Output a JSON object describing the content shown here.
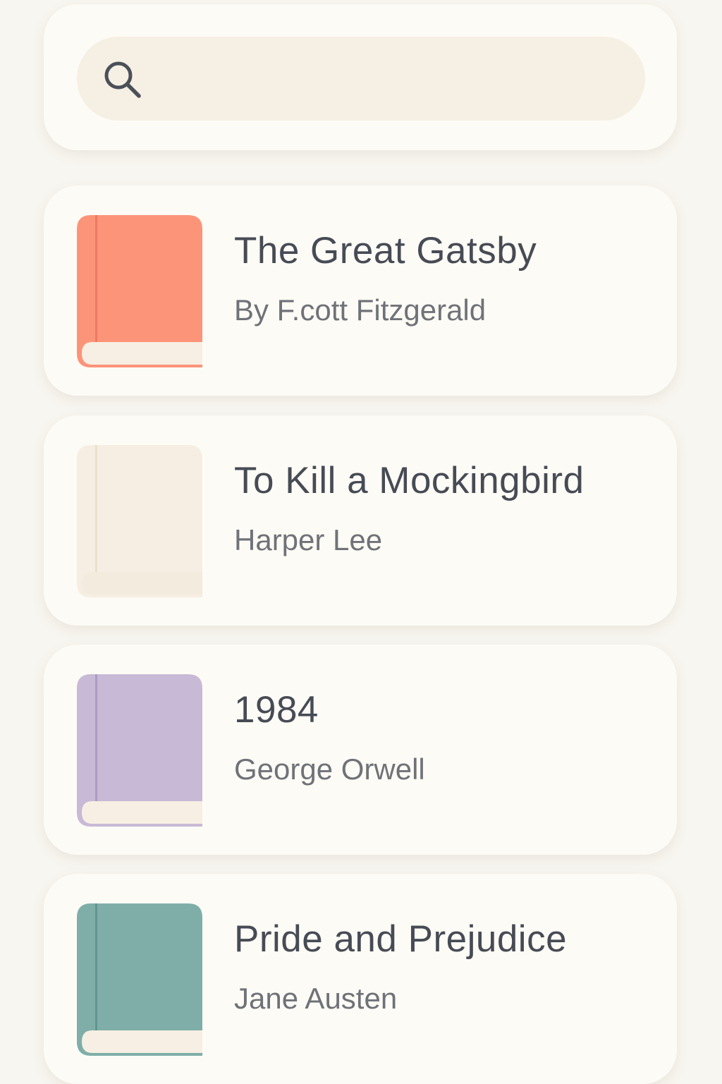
{
  "search": {
    "value": "",
    "placeholder": ""
  },
  "icons": {
    "search": "search-icon",
    "book": "book-icon"
  },
  "books": [
    {
      "title": "The Great Gatsby",
      "author": "By F.cott Fitzgerald",
      "cover_color": "#fc9479",
      "spine_color": "#ef7a64"
    },
    {
      "title": "To Kill a Mockingbird",
      "author": "Harper Lee",
      "cover_color": "#f6eee2",
      "spine_color": "#ebdfcd"
    },
    {
      "title": "1984",
      "author": "George Orwell",
      "cover_color": "#c8b9d6",
      "spine_color": "#ad9bc1"
    },
    {
      "title": "Pride and Prejudice",
      "author": "Jane Austen",
      "cover_color": "#7faea8",
      "spine_color": "#61958f"
    }
  ]
}
